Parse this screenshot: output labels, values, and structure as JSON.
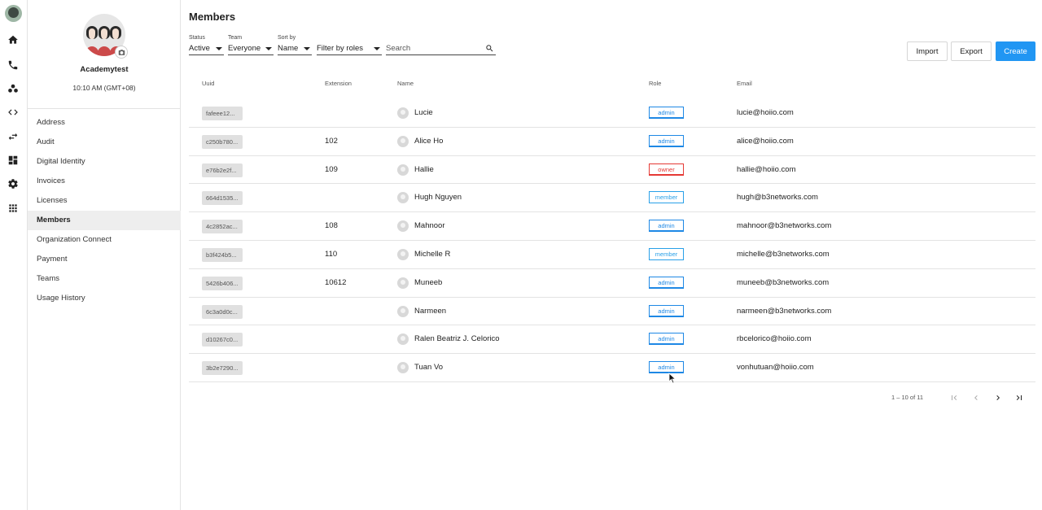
{
  "rail": {
    "icons": [
      "user-avatar",
      "home-icon",
      "phone-icon",
      "team-icon",
      "code-icon",
      "transfer-icon",
      "dashboard-icon",
      "settings-icon",
      "apps-icon"
    ]
  },
  "account": {
    "org_name": "Academytest",
    "local_time": "10:10 AM (GMT+08)",
    "menu": [
      {
        "label": "Address",
        "active": false
      },
      {
        "label": "Audit",
        "active": false
      },
      {
        "label": "Digital Identity",
        "active": false
      },
      {
        "label": "Invoices",
        "active": false
      },
      {
        "label": "Licenses",
        "active": false
      },
      {
        "label": "Members",
        "active": true
      },
      {
        "label": "Organization Connect",
        "active": false
      },
      {
        "label": "Payment",
        "active": false
      },
      {
        "label": "Teams",
        "active": false
      },
      {
        "label": "Usage History",
        "active": false
      }
    ]
  },
  "page": {
    "title": "Members"
  },
  "filters": {
    "status": {
      "label": "Status",
      "value": "Active"
    },
    "team": {
      "label": "Team",
      "value": "Everyone"
    },
    "sort": {
      "label": "Sort by",
      "value": "Name"
    },
    "roles": {
      "value": "Filter by roles"
    },
    "search": {
      "placeholder": "Search"
    }
  },
  "actions": {
    "import": "Import",
    "export": "Export",
    "create": "Create"
  },
  "table": {
    "headers": {
      "uuid": "Uuid",
      "extension": "Extension",
      "name": "Name",
      "role": "Role",
      "email": "Email"
    },
    "rows": [
      {
        "uuid": "fafeee12...",
        "extension": "",
        "name": "Lucie",
        "role": "admin",
        "email": "lucie@hoiio.com"
      },
      {
        "uuid": "c250b780...",
        "extension": "102",
        "name": "Alice Ho",
        "role": "admin",
        "email": "alice@hoiio.com"
      },
      {
        "uuid": "e76b2e2f...",
        "extension": "109",
        "name": "Hallie",
        "role": "owner",
        "email": "hallie@hoiio.com"
      },
      {
        "uuid": "664d1535...",
        "extension": "",
        "name": "Hugh Nguyen",
        "role": "member",
        "email": "hugh@b3networks.com"
      },
      {
        "uuid": "4c2852ac...",
        "extension": "108",
        "name": "Mahnoor",
        "role": "admin",
        "email": "mahnoor@b3networks.com"
      },
      {
        "uuid": "b3f424b5...",
        "extension": "110",
        "name": "Michelle R",
        "role": "member",
        "email": "michelle@b3networks.com"
      },
      {
        "uuid": "5426b406...",
        "extension": "10612",
        "name": "Muneeb",
        "role": "admin",
        "email": "muneeb@b3networks.com"
      },
      {
        "uuid": "6c3a0d0c...",
        "extension": "",
        "name": "Narmeen",
        "role": "admin",
        "email": "narmeen@b3networks.com"
      },
      {
        "uuid": "d10267c0...",
        "extension": "",
        "name": "Ralen Beatriz J. Celorico",
        "role": "admin",
        "email": "rbcelorico@hoiio.com"
      },
      {
        "uuid": "3b2e7290...",
        "extension": "",
        "name": "Tuan Vo",
        "role": "admin",
        "email": "vonhutuan@hoiio.com"
      }
    ]
  },
  "pagination": {
    "range": "1 – 10 of 11"
  },
  "colors": {
    "primary": "#2196f3",
    "admin": "#1e88e5",
    "owner": "#e53935",
    "member": "#29a0e8",
    "active_menu_bg": "#eeeeee"
  }
}
